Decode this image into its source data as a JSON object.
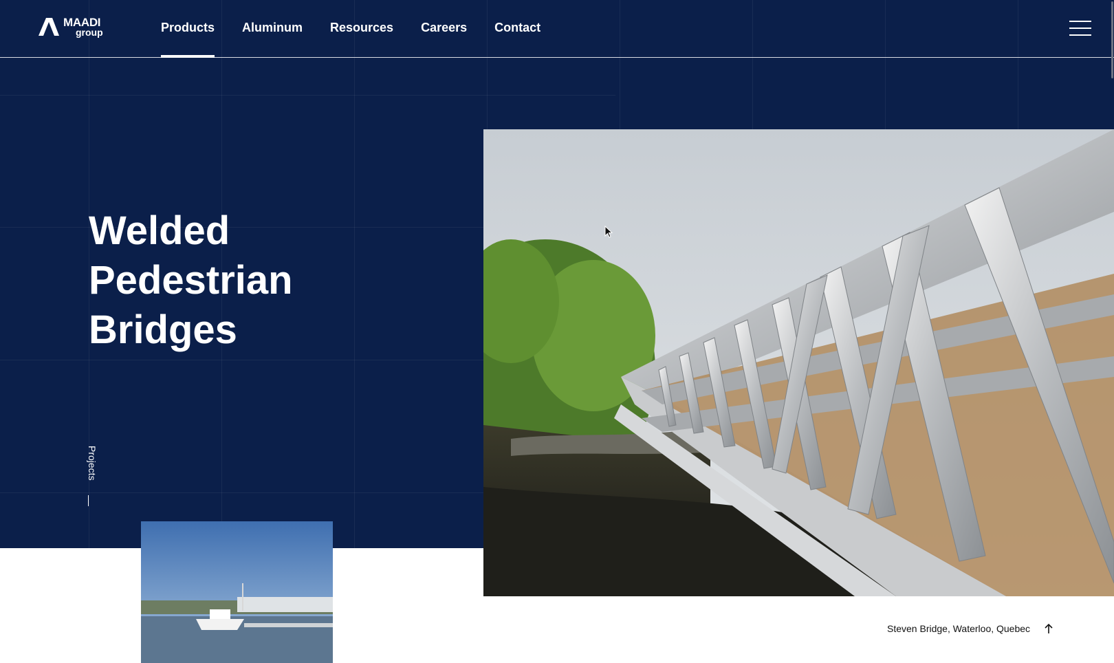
{
  "brand": {
    "name": "MAADI",
    "sub": "group",
    "logo_icon": "maadi-logo-icon"
  },
  "nav": {
    "items": [
      {
        "label": "Products",
        "active": true
      },
      {
        "label": "Aluminum",
        "active": false
      },
      {
        "label": "Resources",
        "active": false
      },
      {
        "label": "Careers",
        "active": false
      },
      {
        "label": "Contact",
        "active": false
      }
    ],
    "menu_icon": "hamburger-menu-icon"
  },
  "hero": {
    "title_lines": [
      "Welded",
      "Pedestrian",
      "Bridges"
    ],
    "side_label": "Projects"
  },
  "main_image": {
    "subject": "aluminum truss pedestrian bridge over river"
  },
  "thumbnail": {
    "subject": "boat docked at a marina"
  },
  "caption": {
    "text": "Steven Bridge, Waterloo, Quebec",
    "icon": "arrow-up-icon"
  },
  "colors": {
    "navy": "#0b1f4a",
    "white": "#ffffff",
    "text_dark": "#111111"
  }
}
